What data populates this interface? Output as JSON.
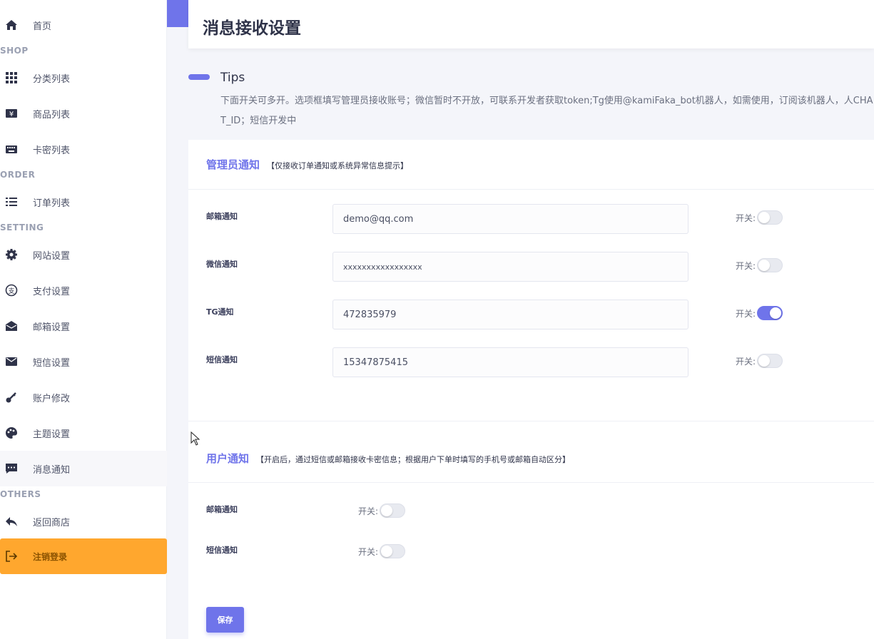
{
  "sidebar": {
    "sections": {
      "shop": "SHOP",
      "order": "ORDER",
      "setting": "SETTING",
      "others": "OTHERS"
    },
    "items": {
      "home": "首页",
      "category": "分类列表",
      "products": "商品列表",
      "cards": "卡密列表",
      "orders": "订单列表",
      "site": "网站设置",
      "payment": "支付设置",
      "mail": "邮箱设置",
      "sms": "短信设置",
      "account": "账户修改",
      "theme": "主题设置",
      "notify": "消息通知",
      "back": "返回商店",
      "logout": "注销登录"
    }
  },
  "page": {
    "title": "消息接收设置"
  },
  "tips": {
    "title": "Tips",
    "text": "下面开关可多开。选项框填写管理员接收账号；微信暂时不开放，可联系开发者获取token;Tg使用@kamiFaka_bot机器人，如需使用，订阅该机器人，人CHAT_ID；短信开发中"
  },
  "admin": {
    "heading": "管理员通知",
    "subheading": "【仅接收订单通知或系统异常信息提示】",
    "rows": [
      {
        "label": "邮箱通知",
        "value": "demo@qq.com",
        "switch_label": "开关:",
        "on": false
      },
      {
        "label": "微信通知",
        "value": "xxxxxxxxxxxxxxxxx",
        "switch_label": "开关:",
        "on": false
      },
      {
        "label": "TG通知",
        "value": "472835979",
        "switch_label": "开关:",
        "on": true
      },
      {
        "label": "短信通知",
        "value": "15347875415",
        "switch_label": "开关:",
        "on": false
      }
    ]
  },
  "user": {
    "heading": "用户通知",
    "subheading": "【开启后，通过短信或邮箱接收卡密信息；根据用户下单时填写的手机号或邮箱自动区分】",
    "rows": [
      {
        "label": "邮箱通知",
        "switch_label": "开关:",
        "on": false
      },
      {
        "label": "短信通知",
        "switch_label": "开关:",
        "on": false
      }
    ]
  },
  "save_label": "保存",
  "colors": {
    "accent": "#6f74ea",
    "logout": "#ffa72e"
  }
}
